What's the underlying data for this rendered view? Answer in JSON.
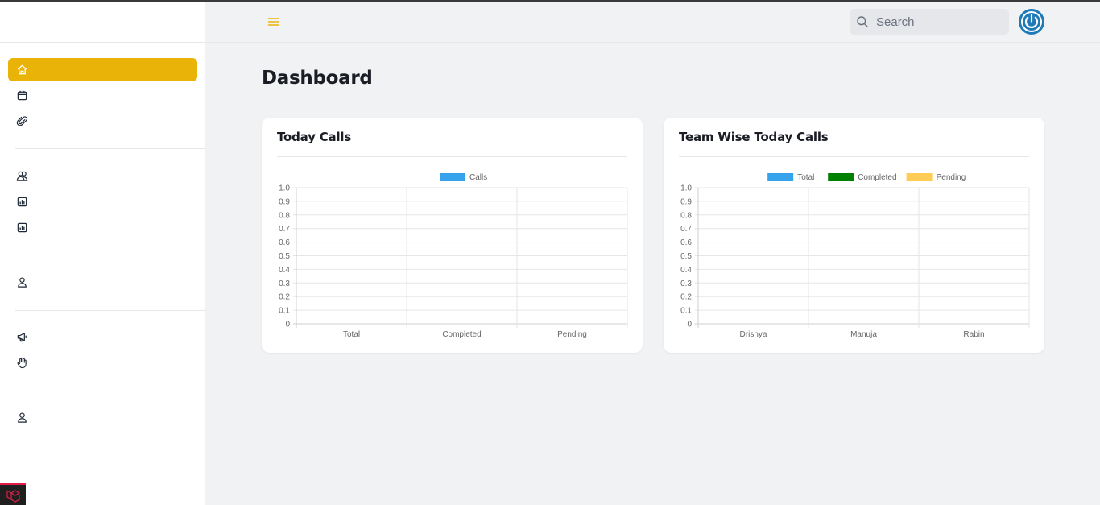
{
  "sidebar": {
    "items": [
      {
        "icon": "home-icon",
        "active": true
      },
      {
        "icon": "calendar-icon",
        "active": false
      },
      {
        "icon": "paperclip-icon",
        "active": false
      },
      {
        "icon": "users-icon",
        "active": false
      },
      {
        "icon": "bar-chart-icon",
        "active": false
      },
      {
        "icon": "bar-chart-icon",
        "active": false
      },
      {
        "icon": "user-icon",
        "active": false
      },
      {
        "icon": "megaphone-icon",
        "active": false
      },
      {
        "icon": "hand-icon",
        "active": false
      },
      {
        "icon": "user-icon",
        "active": false
      }
    ],
    "accent": "#eab308"
  },
  "header": {
    "menu_icon": "hamburger-menu-icon",
    "search_placeholder": "Search",
    "search_icon": "search-icon",
    "power_icon": "power-icon"
  },
  "main": {
    "title": "Dashboard",
    "cards": [
      {
        "title": "Today Calls"
      },
      {
        "title": "Team Wise Today Calls"
      }
    ]
  },
  "colors": {
    "accent": "#eab308",
    "total": "#36a2eb",
    "completed": "#008000",
    "pending": "#ffcd56",
    "power": "#1f7ab8"
  },
  "chart_data": [
    {
      "type": "bar",
      "categories": [
        "Total",
        "Completed",
        "Pending"
      ],
      "series": [
        {
          "name": "Calls",
          "values": [
            0,
            0,
            0
          ],
          "color": "#36a2eb"
        }
      ],
      "ylim": [
        0,
        1.0
      ],
      "yticks": [
        "0",
        "0.1",
        "0.2",
        "0.3",
        "0.4",
        "0.5",
        "0.6",
        "0.7",
        "0.8",
        "0.9",
        "1.0"
      ],
      "grid": true,
      "legend": "top-center"
    },
    {
      "type": "bar",
      "categories": [
        "Drishya",
        "Manuja",
        "Rabin"
      ],
      "series": [
        {
          "name": "Total",
          "values": [
            0,
            0,
            0
          ],
          "color": "#36a2eb"
        },
        {
          "name": "Completed",
          "values": [
            0,
            0,
            0
          ],
          "color": "#008000"
        },
        {
          "name": "Pending",
          "values": [
            0,
            0,
            0
          ],
          "color": "#ffcd56"
        }
      ],
      "ylim": [
        0,
        1.0
      ],
      "yticks": [
        "0",
        "0.1",
        "0.2",
        "0.3",
        "0.4",
        "0.5",
        "0.6",
        "0.7",
        "0.8",
        "0.9",
        "1.0"
      ],
      "grid": true,
      "legend": "top-center"
    }
  ]
}
